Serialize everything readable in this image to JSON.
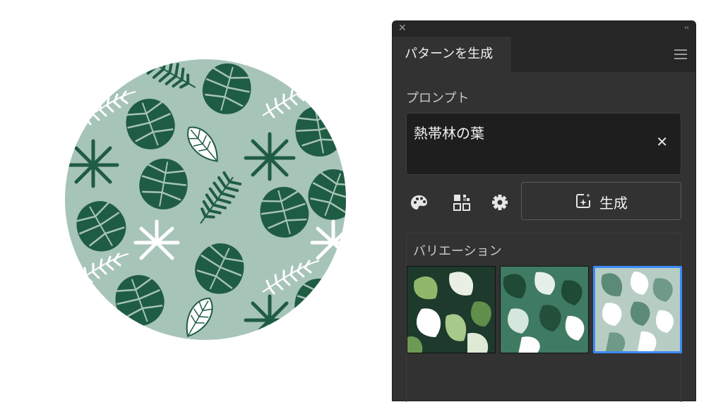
{
  "panel": {
    "close_glyph": "✕",
    "collapse_glyph": "‹‹",
    "tab_title": "パターンを生成",
    "prompt_label": "プロンプト",
    "prompt_value": "熱帯林の葉",
    "clear_glyph": "✕",
    "generate_label": "生成",
    "variations_label": "バリエーション",
    "selected_variation": 3
  },
  "icons": [
    "close-icon",
    "collapse-icon",
    "menu-icon",
    "palette-icon",
    "pattern-grid-icon",
    "gear-icon",
    "generate-sparkle-icon",
    "clear-icon"
  ],
  "colors": {
    "panel_bg": "#323232",
    "tabbar_bg": "#262626",
    "input_bg": "#1e1e1e",
    "selection_accent": "#3d8af7",
    "pattern_bg": "#a7c4b8",
    "leaf_dark": "#1f5c44",
    "leaf_light": "#ffffff"
  }
}
